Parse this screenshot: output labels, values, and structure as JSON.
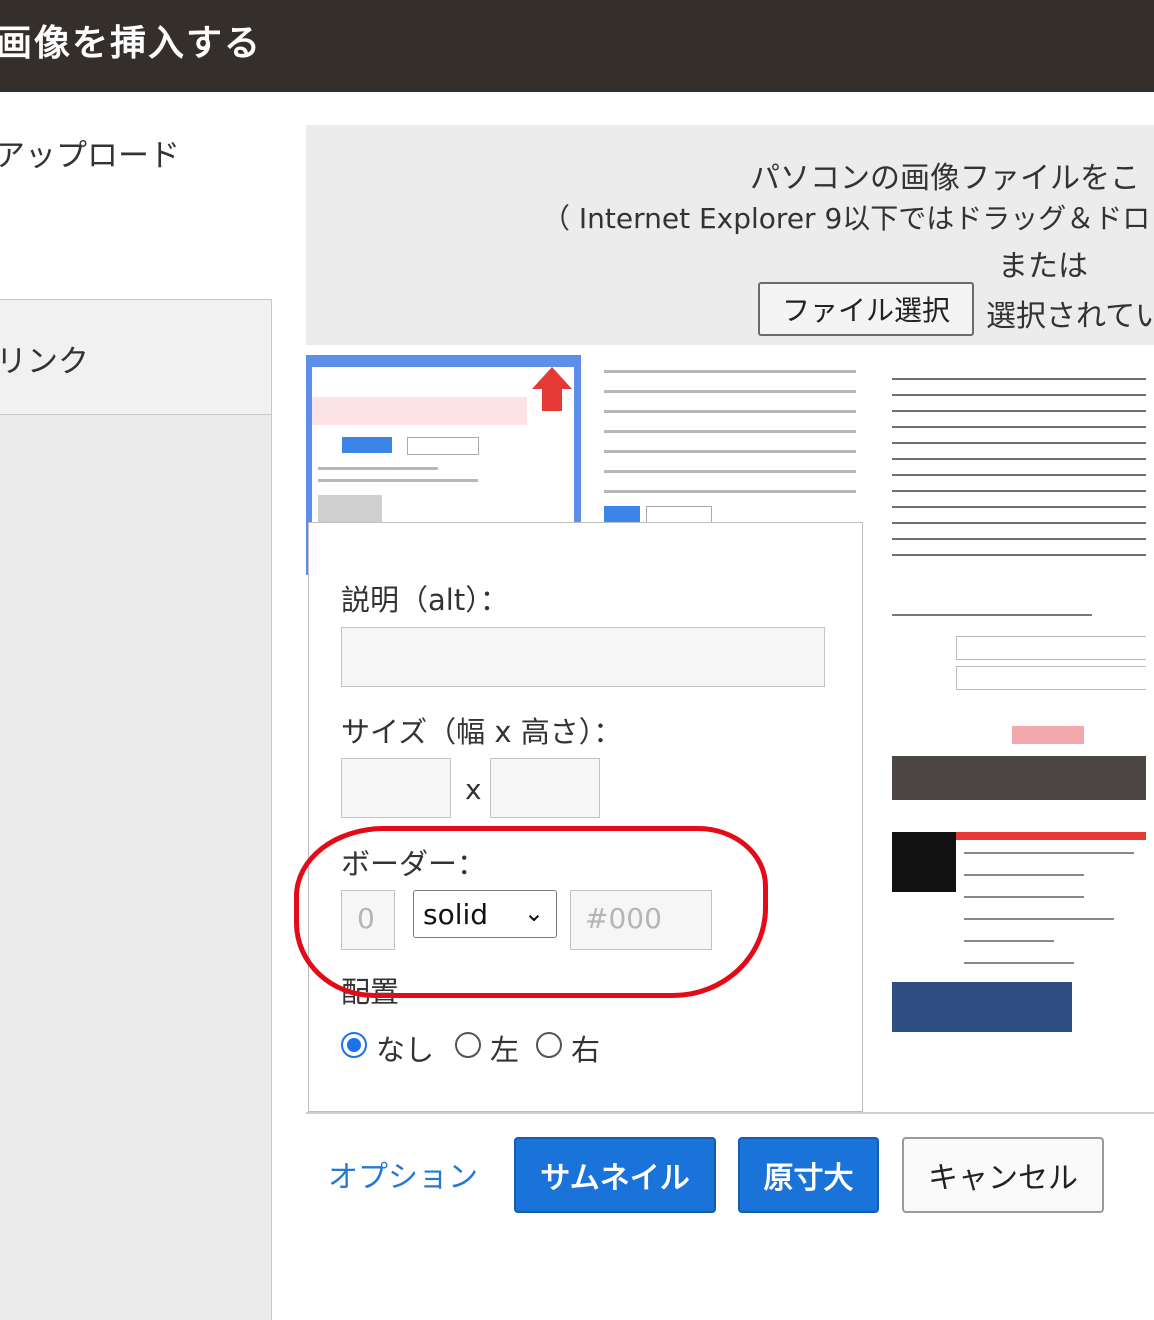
{
  "dialog": {
    "title": "画像を挿入する"
  },
  "sidebar": {
    "items": [
      {
        "label": "アップロード"
      },
      {
        "label": "リンク"
      }
    ]
  },
  "dropzone": {
    "line1": "パソコンの画像ファイルをこ",
    "line2": "（ Internet Explorer 9以下ではドラッグ＆ドロ",
    "line3": "または",
    "file_button": "ファイル選択",
    "file_status": "選択されてい"
  },
  "options": {
    "alt_label": "説明（alt）：",
    "alt_value": "",
    "size_label": "サイズ（幅 x 高さ）：",
    "size_separator": "x",
    "width_value": "",
    "height_value": "",
    "border_label": "ボーダー：",
    "border_width_placeholder": "0",
    "border_style_value": "solid",
    "border_color_placeholder": "#000",
    "align_label": "配置",
    "align_options": [
      {
        "label": "なし",
        "checked": true
      },
      {
        "label": "左",
        "checked": false
      },
      {
        "label": "右",
        "checked": false
      }
    ]
  },
  "footer": {
    "option_link": "オプション",
    "thumbnail_button": "サムネイル",
    "original_button": "原寸大",
    "cancel_button": "キャンセル"
  },
  "colors": {
    "titlebar": "#342f2a",
    "primary": "#1a73d9",
    "link": "#2479d2",
    "annotation": "#e30b17"
  }
}
